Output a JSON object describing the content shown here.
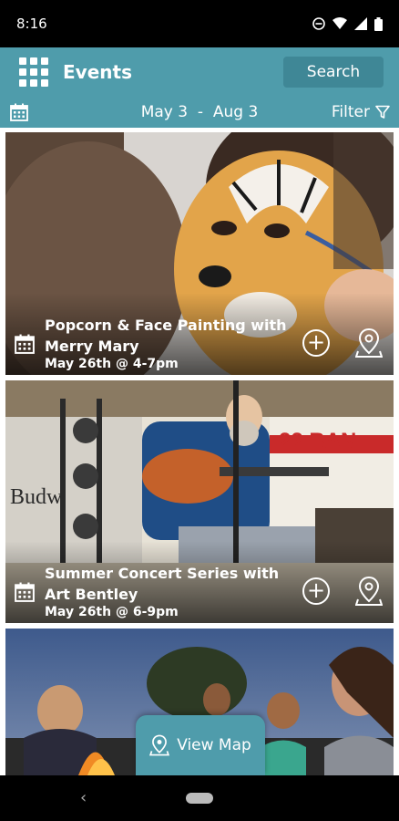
{
  "status_bar": {
    "time": "8:16"
  },
  "header": {
    "title": "Events",
    "search_label": "Search"
  },
  "date_bar": {
    "start": "May 3",
    "separator": "-",
    "end": "Aug 3",
    "filter_label": "Filter"
  },
  "events": [
    {
      "title_line1": "Popcorn & Face Painting with",
      "title_line2": "Merry Mary",
      "date": "May 26th @ 4-7pm"
    },
    {
      "title_line1": "Summer Concert Series with",
      "title_line2": "Art Bentley",
      "date": "May 26th @ 6-9pm"
    }
  ],
  "concert_sign": {
    "text1": "22 BAN",
    "text2": "Budw"
  },
  "view_map_label": "View Map",
  "colors": {
    "primary": "#4f9cab",
    "search_bg": "#3f8796",
    "card_text": "#ffffff"
  }
}
